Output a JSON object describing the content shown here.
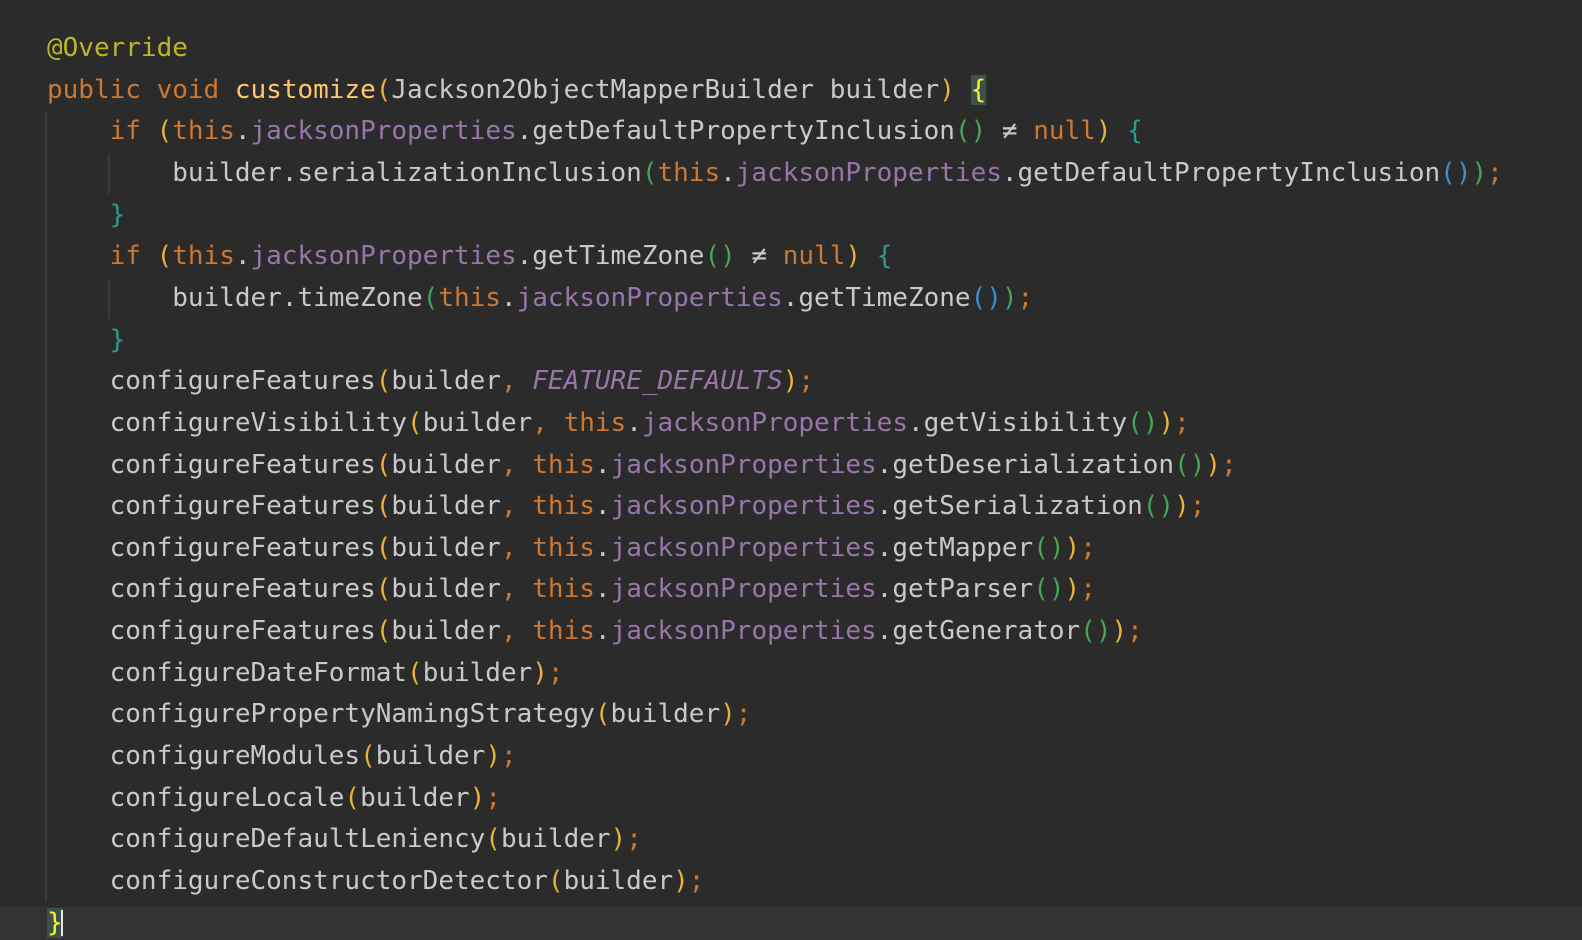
{
  "editor": {
    "theme_colors": {
      "background": "#2b2b2b",
      "annotation": "#bbb529",
      "keyword": "#cc7832",
      "method_declaration": "#ffc66d",
      "field": "#9876aa",
      "plain": "#c9c9c9"
    },
    "lines": [
      [
        {
          "t": "@Override",
          "c": "tok-annotation"
        }
      ],
      [
        {
          "t": "public ",
          "c": "tok-keyword"
        },
        {
          "t": "void ",
          "c": "tok-keyword"
        },
        {
          "t": "customize",
          "c": "tok-method-decl"
        },
        {
          "t": "(",
          "c": "tok-paren-1"
        },
        {
          "t": "Jackson2ObjectMapperBuilder builder",
          "c": "tok-plain"
        },
        {
          "t": ")",
          "c": "tok-paren-1"
        },
        {
          "t": " ",
          "c": "tok-plain"
        },
        {
          "t": "{",
          "c": "brace-hl"
        }
      ],
      [
        {
          "t": "    if ",
          "c": "tok-keyword"
        },
        {
          "t": "(",
          "c": "tok-paren-1"
        },
        {
          "t": "this",
          "c": "tok-keyword"
        },
        {
          "t": ".",
          "c": "tok-plain"
        },
        {
          "t": "jacksonProperties",
          "c": "tok-field"
        },
        {
          "t": ".getDefaultPropertyInclusion",
          "c": "tok-plain"
        },
        {
          "t": "()",
          "c": "tok-paren-2"
        },
        {
          "t": " ≠ ",
          "c": "tok-plain"
        },
        {
          "t": "null",
          "c": "tok-keyword"
        },
        {
          "t": ")",
          "c": "tok-paren-1"
        },
        {
          "t": " ",
          "c": "tok-plain"
        },
        {
          "t": "{",
          "c": "tok-brace-2"
        }
      ],
      [
        {
          "t": "        builder.serializationInclusion",
          "c": "tok-plain"
        },
        {
          "t": "(",
          "c": "tok-paren-2"
        },
        {
          "t": "this",
          "c": "tok-keyword"
        },
        {
          "t": ".",
          "c": "tok-plain"
        },
        {
          "t": "jacksonProperties",
          "c": "tok-field"
        },
        {
          "t": ".getDefaultPropertyInclusion",
          "c": "tok-plain"
        },
        {
          "t": "()",
          "c": "tok-paren-3"
        },
        {
          "t": ")",
          "c": "tok-paren-2"
        },
        {
          "t": ";",
          "c": "tok-punct"
        }
      ],
      [
        {
          "t": "    ",
          "c": "tok-plain"
        },
        {
          "t": "}",
          "c": "tok-brace-2"
        }
      ],
      [
        {
          "t": "    if ",
          "c": "tok-keyword"
        },
        {
          "t": "(",
          "c": "tok-paren-1"
        },
        {
          "t": "this",
          "c": "tok-keyword"
        },
        {
          "t": ".",
          "c": "tok-plain"
        },
        {
          "t": "jacksonProperties",
          "c": "tok-field"
        },
        {
          "t": ".getTimeZone",
          "c": "tok-plain"
        },
        {
          "t": "()",
          "c": "tok-paren-2"
        },
        {
          "t": " ≠ ",
          "c": "tok-plain"
        },
        {
          "t": "null",
          "c": "tok-keyword"
        },
        {
          "t": ")",
          "c": "tok-paren-1"
        },
        {
          "t": " ",
          "c": "tok-plain"
        },
        {
          "t": "{",
          "c": "tok-brace-2"
        }
      ],
      [
        {
          "t": "        builder.timeZone",
          "c": "tok-plain"
        },
        {
          "t": "(",
          "c": "tok-paren-2"
        },
        {
          "t": "this",
          "c": "tok-keyword"
        },
        {
          "t": ".",
          "c": "tok-plain"
        },
        {
          "t": "jacksonProperties",
          "c": "tok-field"
        },
        {
          "t": ".getTimeZone",
          "c": "tok-plain"
        },
        {
          "t": "()",
          "c": "tok-paren-3"
        },
        {
          "t": ")",
          "c": "tok-paren-2"
        },
        {
          "t": ";",
          "c": "tok-punct"
        }
      ],
      [
        {
          "t": "    ",
          "c": "tok-plain"
        },
        {
          "t": "}",
          "c": "tok-brace-2"
        }
      ],
      [
        {
          "t": "    configureFeatures",
          "c": "tok-plain"
        },
        {
          "t": "(",
          "c": "tok-paren-1"
        },
        {
          "t": "builder",
          "c": "tok-plain"
        },
        {
          "t": ", ",
          "c": "tok-punct"
        },
        {
          "t": "FEATURE_DEFAULTS",
          "c": "tok-const"
        },
        {
          "t": ")",
          "c": "tok-paren-1"
        },
        {
          "t": ";",
          "c": "tok-punct"
        }
      ],
      [
        {
          "t": "    configureVisibility",
          "c": "tok-plain"
        },
        {
          "t": "(",
          "c": "tok-paren-1"
        },
        {
          "t": "builder",
          "c": "tok-plain"
        },
        {
          "t": ", ",
          "c": "tok-punct"
        },
        {
          "t": "this",
          "c": "tok-keyword"
        },
        {
          "t": ".",
          "c": "tok-plain"
        },
        {
          "t": "jacksonProperties",
          "c": "tok-field"
        },
        {
          "t": ".getVisibility",
          "c": "tok-plain"
        },
        {
          "t": "()",
          "c": "tok-paren-2"
        },
        {
          "t": ")",
          "c": "tok-paren-1"
        },
        {
          "t": ";",
          "c": "tok-punct"
        }
      ],
      [
        {
          "t": "    configureFeatures",
          "c": "tok-plain"
        },
        {
          "t": "(",
          "c": "tok-paren-1"
        },
        {
          "t": "builder",
          "c": "tok-plain"
        },
        {
          "t": ", ",
          "c": "tok-punct"
        },
        {
          "t": "this",
          "c": "tok-keyword"
        },
        {
          "t": ".",
          "c": "tok-plain"
        },
        {
          "t": "jacksonProperties",
          "c": "tok-field"
        },
        {
          "t": ".getDeserialization",
          "c": "tok-plain"
        },
        {
          "t": "()",
          "c": "tok-paren-2"
        },
        {
          "t": ")",
          "c": "tok-paren-1"
        },
        {
          "t": ";",
          "c": "tok-punct"
        }
      ],
      [
        {
          "t": "    configureFeatures",
          "c": "tok-plain"
        },
        {
          "t": "(",
          "c": "tok-paren-1"
        },
        {
          "t": "builder",
          "c": "tok-plain"
        },
        {
          "t": ", ",
          "c": "tok-punct"
        },
        {
          "t": "this",
          "c": "tok-keyword"
        },
        {
          "t": ".",
          "c": "tok-plain"
        },
        {
          "t": "jacksonProperties",
          "c": "tok-field"
        },
        {
          "t": ".getSerialization",
          "c": "tok-plain"
        },
        {
          "t": "()",
          "c": "tok-paren-2"
        },
        {
          "t": ")",
          "c": "tok-paren-1"
        },
        {
          "t": ";",
          "c": "tok-punct"
        }
      ],
      [
        {
          "t": "    configureFeatures",
          "c": "tok-plain"
        },
        {
          "t": "(",
          "c": "tok-paren-1"
        },
        {
          "t": "builder",
          "c": "tok-plain"
        },
        {
          "t": ", ",
          "c": "tok-punct"
        },
        {
          "t": "this",
          "c": "tok-keyword"
        },
        {
          "t": ".",
          "c": "tok-plain"
        },
        {
          "t": "jacksonProperties",
          "c": "tok-field"
        },
        {
          "t": ".getMapper",
          "c": "tok-plain"
        },
        {
          "t": "()",
          "c": "tok-paren-2"
        },
        {
          "t": ")",
          "c": "tok-paren-1"
        },
        {
          "t": ";",
          "c": "tok-punct"
        }
      ],
      [
        {
          "t": "    configureFeatures",
          "c": "tok-plain"
        },
        {
          "t": "(",
          "c": "tok-paren-1"
        },
        {
          "t": "builder",
          "c": "tok-plain"
        },
        {
          "t": ", ",
          "c": "tok-punct"
        },
        {
          "t": "this",
          "c": "tok-keyword"
        },
        {
          "t": ".",
          "c": "tok-plain"
        },
        {
          "t": "jacksonProperties",
          "c": "tok-field"
        },
        {
          "t": ".getParser",
          "c": "tok-plain"
        },
        {
          "t": "()",
          "c": "tok-paren-2"
        },
        {
          "t": ")",
          "c": "tok-paren-1"
        },
        {
          "t": ";",
          "c": "tok-punct"
        }
      ],
      [
        {
          "t": "    configureFeatures",
          "c": "tok-plain"
        },
        {
          "t": "(",
          "c": "tok-paren-1"
        },
        {
          "t": "builder",
          "c": "tok-plain"
        },
        {
          "t": ", ",
          "c": "tok-punct"
        },
        {
          "t": "this",
          "c": "tok-keyword"
        },
        {
          "t": ".",
          "c": "tok-plain"
        },
        {
          "t": "jacksonProperties",
          "c": "tok-field"
        },
        {
          "t": ".getGenerator",
          "c": "tok-plain"
        },
        {
          "t": "()",
          "c": "tok-paren-2"
        },
        {
          "t": ")",
          "c": "tok-paren-1"
        },
        {
          "t": ";",
          "c": "tok-punct"
        }
      ],
      [
        {
          "t": "    configureDateFormat",
          "c": "tok-plain"
        },
        {
          "t": "(",
          "c": "tok-paren-1"
        },
        {
          "t": "builder",
          "c": "tok-plain"
        },
        {
          "t": ")",
          "c": "tok-paren-1"
        },
        {
          "t": ";",
          "c": "tok-punct"
        }
      ],
      [
        {
          "t": "    configurePropertyNamingStrategy",
          "c": "tok-plain"
        },
        {
          "t": "(",
          "c": "tok-paren-1"
        },
        {
          "t": "builder",
          "c": "tok-plain"
        },
        {
          "t": ")",
          "c": "tok-paren-1"
        },
        {
          "t": ";",
          "c": "tok-punct"
        }
      ],
      [
        {
          "t": "    configureModules",
          "c": "tok-plain"
        },
        {
          "t": "(",
          "c": "tok-paren-1"
        },
        {
          "t": "builder",
          "c": "tok-plain"
        },
        {
          "t": ")",
          "c": "tok-paren-1"
        },
        {
          "t": ";",
          "c": "tok-punct"
        }
      ],
      [
        {
          "t": "    configureLocale",
          "c": "tok-plain"
        },
        {
          "t": "(",
          "c": "tok-paren-1"
        },
        {
          "t": "builder",
          "c": "tok-plain"
        },
        {
          "t": ")",
          "c": "tok-paren-1"
        },
        {
          "t": ";",
          "c": "tok-punct"
        }
      ],
      [
        {
          "t": "    configureDefaultLeniency",
          "c": "tok-plain"
        },
        {
          "t": "(",
          "c": "tok-paren-1"
        },
        {
          "t": "builder",
          "c": "tok-plain"
        },
        {
          "t": ")",
          "c": "tok-paren-1"
        },
        {
          "t": ";",
          "c": "tok-punct"
        }
      ],
      [
        {
          "t": "    configureConstructorDetector",
          "c": "tok-plain"
        },
        {
          "t": "(",
          "c": "tok-paren-1"
        },
        {
          "t": "builder",
          "c": "tok-plain"
        },
        {
          "t": ")",
          "c": "tok-paren-1"
        },
        {
          "t": ";",
          "c": "tok-punct"
        }
      ],
      [
        {
          "t": "}",
          "c": "brace-hl"
        }
      ]
    ]
  }
}
